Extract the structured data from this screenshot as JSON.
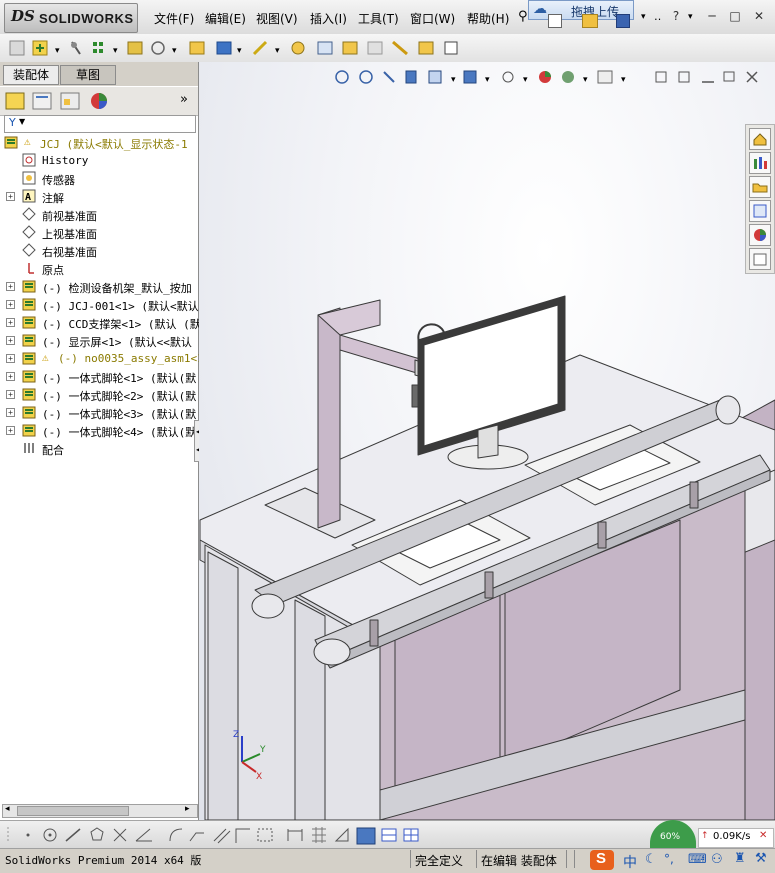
{
  "app": {
    "logo_brand": "DS",
    "logo_text": "SOLIDWORKS",
    "menus": [
      "文件(F)",
      "编辑(E)",
      "视图(V)",
      "插入(I)",
      "工具(T)",
      "窗口(W)",
      "帮助(H)"
    ],
    "upload_label": "拖拽上传",
    "help_glyph": "?",
    "window_buttons": [
      "─",
      "□",
      "✕"
    ]
  },
  "panel": {
    "tabs": [
      "装配体",
      "草图"
    ],
    "active_tab": 0,
    "more_glyph": "»",
    "filter_glyph": "▼"
  },
  "tree": [
    {
      "label": "JCJ  (默认<默认_显示状态-1",
      "icon": "assembly-warning-icon",
      "expander": false,
      "indent": 0
    },
    {
      "label": "History",
      "icon": "history-icon",
      "expander": false,
      "indent": 1
    },
    {
      "label": "传感器",
      "icon": "sensor-icon",
      "expander": false,
      "indent": 1
    },
    {
      "label": "注解",
      "icon": "annotation-icon",
      "expander": true,
      "indent": 1
    },
    {
      "label": "前视基准面",
      "icon": "plane-icon",
      "expander": false,
      "indent": 1
    },
    {
      "label": "上视基准面",
      "icon": "plane-icon",
      "expander": false,
      "indent": 1
    },
    {
      "label": "右视基准面",
      "icon": "plane-icon",
      "expander": false,
      "indent": 1
    },
    {
      "label": "原点",
      "icon": "origin-icon",
      "expander": false,
      "indent": 1
    },
    {
      "label": "(-) 检测设备机架_默认_按加",
      "icon": "subassembly-icon",
      "expander": true,
      "indent": 1
    },
    {
      "label": "(-) JCJ-001<1> (默认<默认",
      "icon": "subassembly-icon",
      "expander": true,
      "indent": 1
    },
    {
      "label": "(-) CCD支撑架<1> (默认 (默",
      "icon": "subassembly-icon",
      "expander": true,
      "indent": 1
    },
    {
      "label": "(-) 显示屏<1> (默认<<默认",
      "icon": "subassembly-icon",
      "expander": true,
      "indent": 1
    },
    {
      "label": "(-) no0035_assy_asm1<1>",
      "icon": "subassembly-warning-icon",
      "expander": true,
      "indent": 1,
      "warning": true
    },
    {
      "label": "(-) 一体式脚轮<1> (默认(默",
      "icon": "subassembly-icon",
      "expander": true,
      "indent": 1
    },
    {
      "label": "(-) 一体式脚轮<2> (默认(默",
      "icon": "subassembly-icon",
      "expander": true,
      "indent": 1
    },
    {
      "label": "(-) 一体式脚轮<3> (默认(默",
      "icon": "subassembly-icon",
      "expander": true,
      "indent": 1
    },
    {
      "label": "(-) 一体式脚轮<4> (默认(默",
      "icon": "subassembly-icon",
      "expander": true,
      "indent": 1
    },
    {
      "label": "配合",
      "icon": "mates-icon",
      "expander": false,
      "indent": 1
    }
  ],
  "triad": {
    "x": "X",
    "y": "Y",
    "z": "Z"
  },
  "status": {
    "product": "SolidWorks Premium 2014 x64 版",
    "definition": "完全定义",
    "mode": "在编辑 装配体"
  },
  "tray": {
    "ime_logo": "S",
    "ime_lang": "中",
    "gauge": "60%",
    "net_speed": "0.09K/s"
  },
  "colors": {
    "model_body": "#c8bbc8",
    "model_edge": "#3a3a3a",
    "warning": "#e6b800",
    "accent": "#2d5fa4"
  }
}
